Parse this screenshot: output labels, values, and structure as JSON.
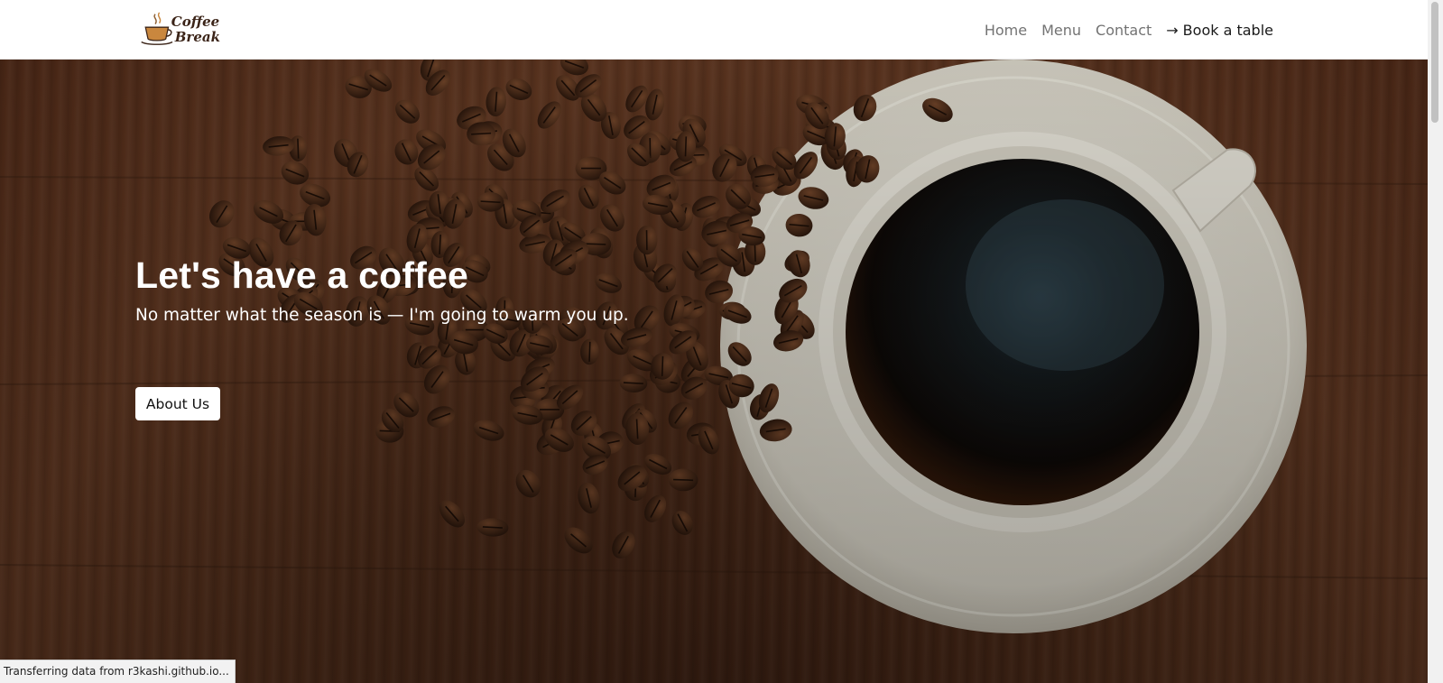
{
  "brand": {
    "line1": "Coffee",
    "line2": "Break",
    "logo_icon": "coffee-cup-icon"
  },
  "nav": {
    "items": [
      {
        "label": "Home"
      },
      {
        "label": "Menu"
      },
      {
        "label": "Contact"
      }
    ],
    "cta": {
      "label": "Book a table",
      "icon": "arrow-right-icon"
    }
  },
  "hero": {
    "title": "Let's have a coffee",
    "subtitle": "No matter what the season is — I'm going to warm you up.",
    "button_label": "About Us",
    "background_subject": "coffee-cup-and-beans-on-wooden-table"
  },
  "status": {
    "text": "Transferring data from r3kashi.github.io..."
  },
  "colors": {
    "nav_link": "#737373",
    "nav_cta": "#1a1a1a",
    "hero_text": "#ffffff",
    "wood": "#4b2a18",
    "saucer": "#d6d3c8",
    "coffee": "#120d08"
  }
}
